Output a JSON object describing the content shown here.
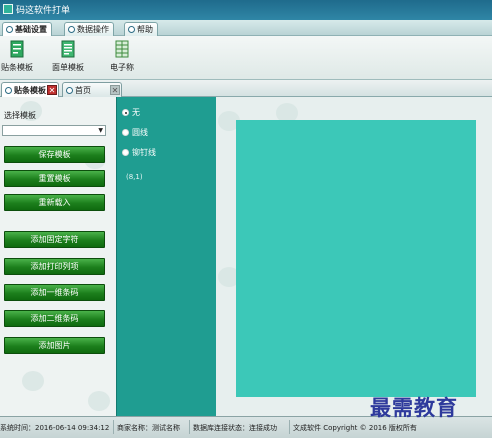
{
  "window": {
    "title": "码这软件打单"
  },
  "menu_tabs": [
    {
      "label": "基础设置",
      "active": true
    },
    {
      "label": "数据操作",
      "active": false
    },
    {
      "label": "帮助",
      "active": false
    }
  ],
  "toolbar": {
    "items": [
      {
        "label": "贴条模板",
        "icon": "template-icon"
      },
      {
        "label": "面单模板",
        "icon": "waybill-template-icon"
      },
      {
        "label": "电子称",
        "icon": "scale-icon"
      }
    ]
  },
  "doc_tabs": [
    {
      "label": "贴条模板",
      "active": true
    },
    {
      "label": "首页",
      "active": false
    }
  ],
  "left_panel": {
    "select_label": "选择模板",
    "select_value": "",
    "buttons": [
      "保存模板",
      "重置模板",
      "重新载入",
      "添加固定字符",
      "添加打印列项",
      "添加一维条码",
      "添加二维条码",
      "添加图片"
    ]
  },
  "radio_panel": {
    "options": [
      {
        "label": "无",
        "checked": true
      },
      {
        "label": "圆线",
        "checked": false
      },
      {
        "label": "铆钉线",
        "checked": false
      }
    ],
    "coords": "(8,1)"
  },
  "canvas": {
    "color": "#3cc8b8"
  },
  "status_bar": {
    "time": "系统时间：2016-06-14 09:34:12",
    "shop": "商家名称：测试名称",
    "db_status": "数据库连接状态：连接成功",
    "copyright": "文成软件 Copyright © 2016 版权所有"
  },
  "watermark": "最需教育",
  "colors": {
    "accent": "#1f9d91",
    "button_green": "#1c7f1c",
    "title_bar": "#1f6b8c",
    "watermark": "#2e3a9c"
  }
}
